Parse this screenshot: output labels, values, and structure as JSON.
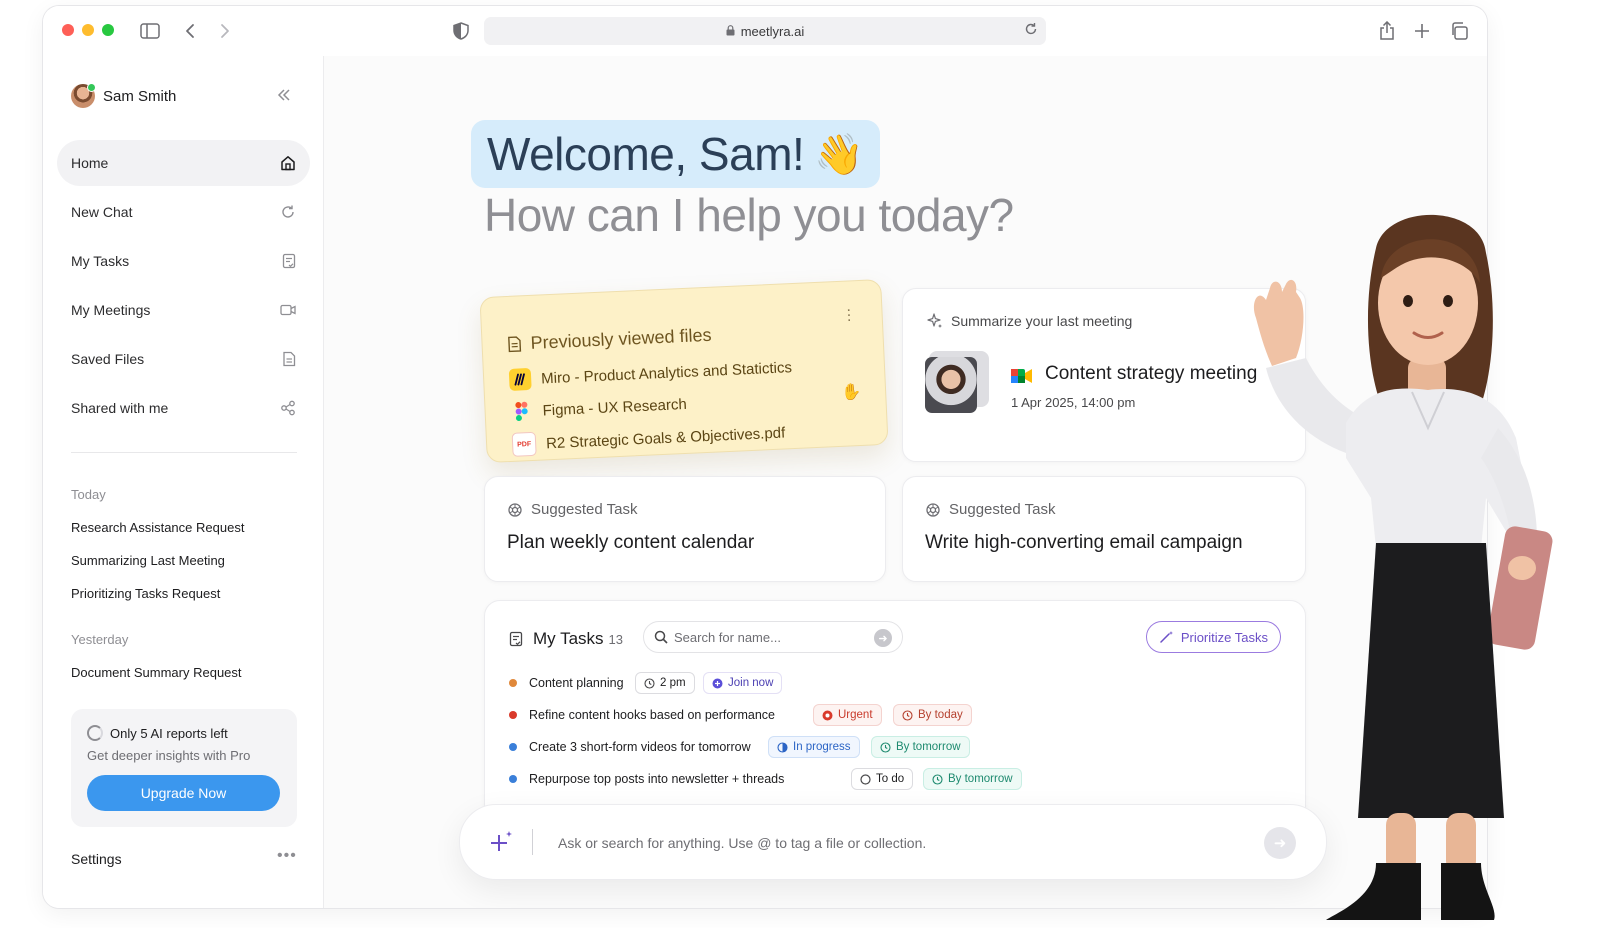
{
  "browser": {
    "url": "meetlyra.ai"
  },
  "sidebar": {
    "user_name": "Sam Smith",
    "nav": [
      {
        "label": "Home",
        "icon": "home-icon",
        "active": true
      },
      {
        "label": "New Chat",
        "icon": "refresh-chat-icon"
      },
      {
        "label": "My Tasks",
        "icon": "tasks-icon"
      },
      {
        "label": "My Meetings",
        "icon": "video-icon"
      },
      {
        "label": "Saved Files",
        "icon": "file-icon"
      },
      {
        "label": "Shared with me",
        "icon": "share-icon"
      }
    ],
    "today_label": "Today",
    "today_items": [
      "Research Assistance Request",
      "Summarizing Last Meeting",
      "Prioritizing Tasks Request"
    ],
    "yesterday_label": "Yesterday",
    "yesterday_items": [
      "Document Summary Request"
    ],
    "promo": {
      "title": "Only 5 AI reports left",
      "subtitle": "Get deeper insights with Pro",
      "button": "Upgrade Now"
    },
    "settings_label": "Settings"
  },
  "main": {
    "welcome": "Welcome, Sam!",
    "wave_emoji": "👋",
    "subtitle": "How can I help you today?",
    "files_card": {
      "title": "Previously viewed files",
      "files": [
        {
          "name": "Miro - Product Analytics and Statictics",
          "icon": "miro-icon"
        },
        {
          "name": "Figma - UX Research",
          "icon": "figma-icon"
        },
        {
          "name": "R2 Strategic Goals & Objectives.pdf",
          "icon": "pdf-icon"
        }
      ]
    },
    "meeting_card": {
      "header": "Summarize your last meeting",
      "title": "Content strategy meeting",
      "date": "1 Apr  2025, 14:00 pm"
    },
    "suggested": [
      {
        "header": "Suggested Task",
        "title": "Plan weekly content calendar"
      },
      {
        "header": "Suggested Task",
        "title": "Write high-converting email campaign"
      }
    ],
    "tasks_panel": {
      "title": "My Tasks",
      "count": "13",
      "search_placeholder": "Search for name...",
      "prioritize_label": "Prioritize Tasks",
      "rows": [
        {
          "name": "Content planning",
          "bullet_color": "#e0883a",
          "tags": [
            "2 pm",
            "Join now"
          ]
        },
        {
          "name": "Refine content hooks based on performance",
          "bullet_color": "#d93a2b",
          "tags": [
            "Urgent",
            "By today"
          ]
        },
        {
          "name": "Create 3 short-form videos for tomorrow",
          "bullet_color": "#3a7fd9",
          "tags": [
            "In progress",
            "By tomorrow"
          ]
        },
        {
          "name": "Repurpose top posts into newsletter + threads",
          "bullet_color": "#3a7fd9",
          "tags": [
            "To do",
            "By tomorrow"
          ]
        }
      ]
    },
    "chat": {
      "placeholder": "Ask or search for anything. Use @ to tag a file or collection."
    }
  },
  "colors": {
    "accent": "#3b97ee",
    "welcome_bg": "#d6ecfb",
    "files_card_bg": "#fdf1c8",
    "prioritize_accent": "#9b7be0"
  }
}
